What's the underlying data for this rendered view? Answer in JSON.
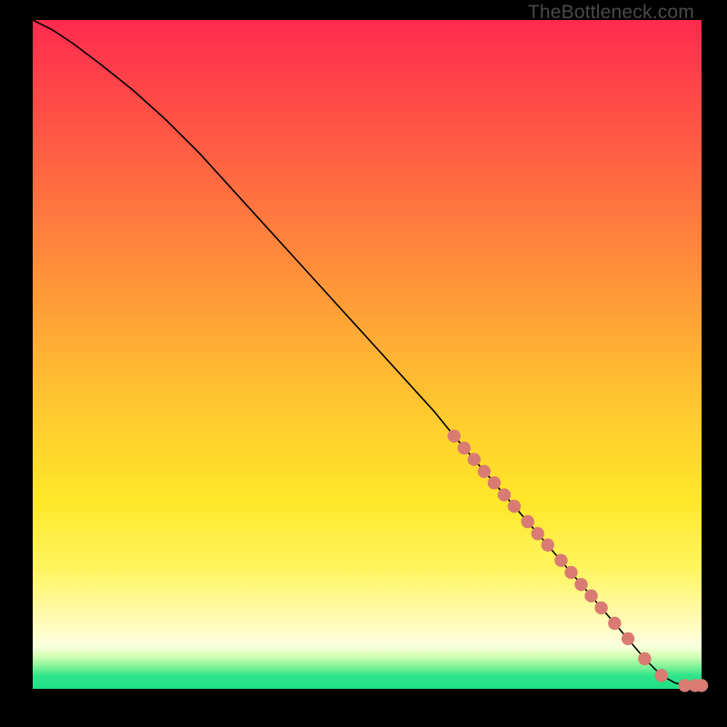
{
  "watermark": "TheBottleneck.com",
  "colors": {
    "dot": "#d97b72",
    "curve": "#000000",
    "frame_bg": "#000000"
  },
  "chart_data": {
    "type": "line",
    "title": "",
    "xlabel": "",
    "ylabel": "",
    "xlim": [
      0,
      100
    ],
    "ylim": [
      0,
      100
    ],
    "grid": false,
    "legend_position": "none",
    "series": [
      {
        "name": "bottleneck_curve",
        "x": [
          0,
          3,
          6,
          10,
          15,
          20,
          25,
          30,
          35,
          40,
          45,
          50,
          55,
          60,
          63,
          66,
          69,
          72,
          75,
          78,
          81,
          84,
          87,
          91.5,
          94,
          96,
          97.5,
          99,
          100
        ],
        "y": [
          100,
          98.5,
          96.5,
          93.5,
          89.5,
          85,
          80,
          74.5,
          69,
          63.5,
          58,
          52.5,
          47,
          41.5,
          37.8,
          34.3,
          30.8,
          27.3,
          23.8,
          20.3,
          16.8,
          13.3,
          9.8,
          4.5,
          2.0,
          0.9,
          0.5,
          0.5,
          0.5
        ]
      }
    ],
    "scatter": {
      "name": "marked_points",
      "points": [
        {
          "x": 63.0,
          "y": 37.8
        },
        {
          "x": 64.5,
          "y": 36.0
        },
        {
          "x": 66.0,
          "y": 34.3
        },
        {
          "x": 67.5,
          "y": 32.5
        },
        {
          "x": 69.0,
          "y": 30.8
        },
        {
          "x": 70.5,
          "y": 29.0
        },
        {
          "x": 72.0,
          "y": 27.3
        },
        {
          "x": 74.0,
          "y": 25.0
        },
        {
          "x": 75.5,
          "y": 23.2
        },
        {
          "x": 77.0,
          "y": 21.5
        },
        {
          "x": 79.0,
          "y": 19.2
        },
        {
          "x": 80.5,
          "y": 17.4
        },
        {
          "x": 82.0,
          "y": 15.6
        },
        {
          "x": 83.5,
          "y": 13.9
        },
        {
          "x": 85.0,
          "y": 12.1
        },
        {
          "x": 87.0,
          "y": 9.8
        },
        {
          "x": 89.0,
          "y": 7.5
        },
        {
          "x": 91.5,
          "y": 4.5
        },
        {
          "x": 94.0,
          "y": 2.0
        },
        {
          "x": 97.5,
          "y": 0.5
        },
        {
          "x": 99.0,
          "y": 0.5
        },
        {
          "x": 100.0,
          "y": 0.5
        }
      ]
    }
  }
}
